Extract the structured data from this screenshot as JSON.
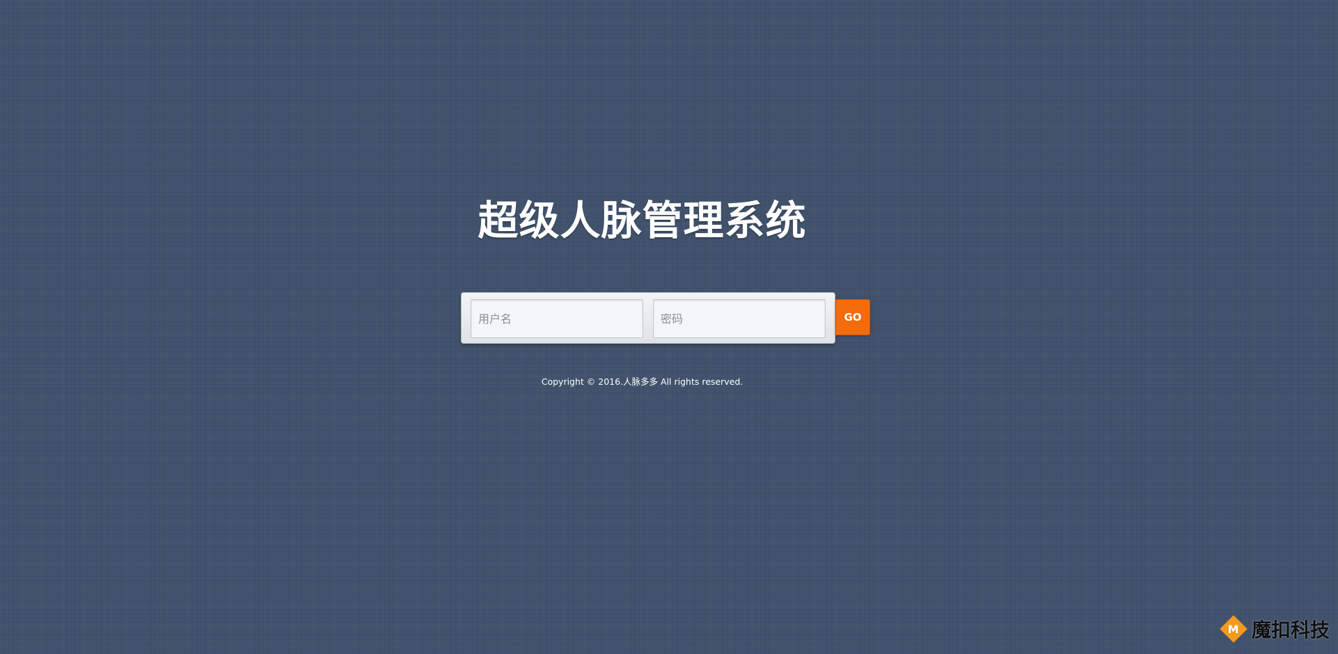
{
  "title": "超级人脉管理系统",
  "login": {
    "username_placeholder": "用户名",
    "password_placeholder": "密码",
    "submit_label": "GO"
  },
  "footer": {
    "copyright": "Copyright © 2016.人脉多多 All rights reserved."
  },
  "watermark": {
    "logo_letter": "M",
    "text": "魔扣科技"
  },
  "colors": {
    "background": "#42536e",
    "accent": "#f26c0e",
    "watermark_logo": "#f39a1d"
  }
}
